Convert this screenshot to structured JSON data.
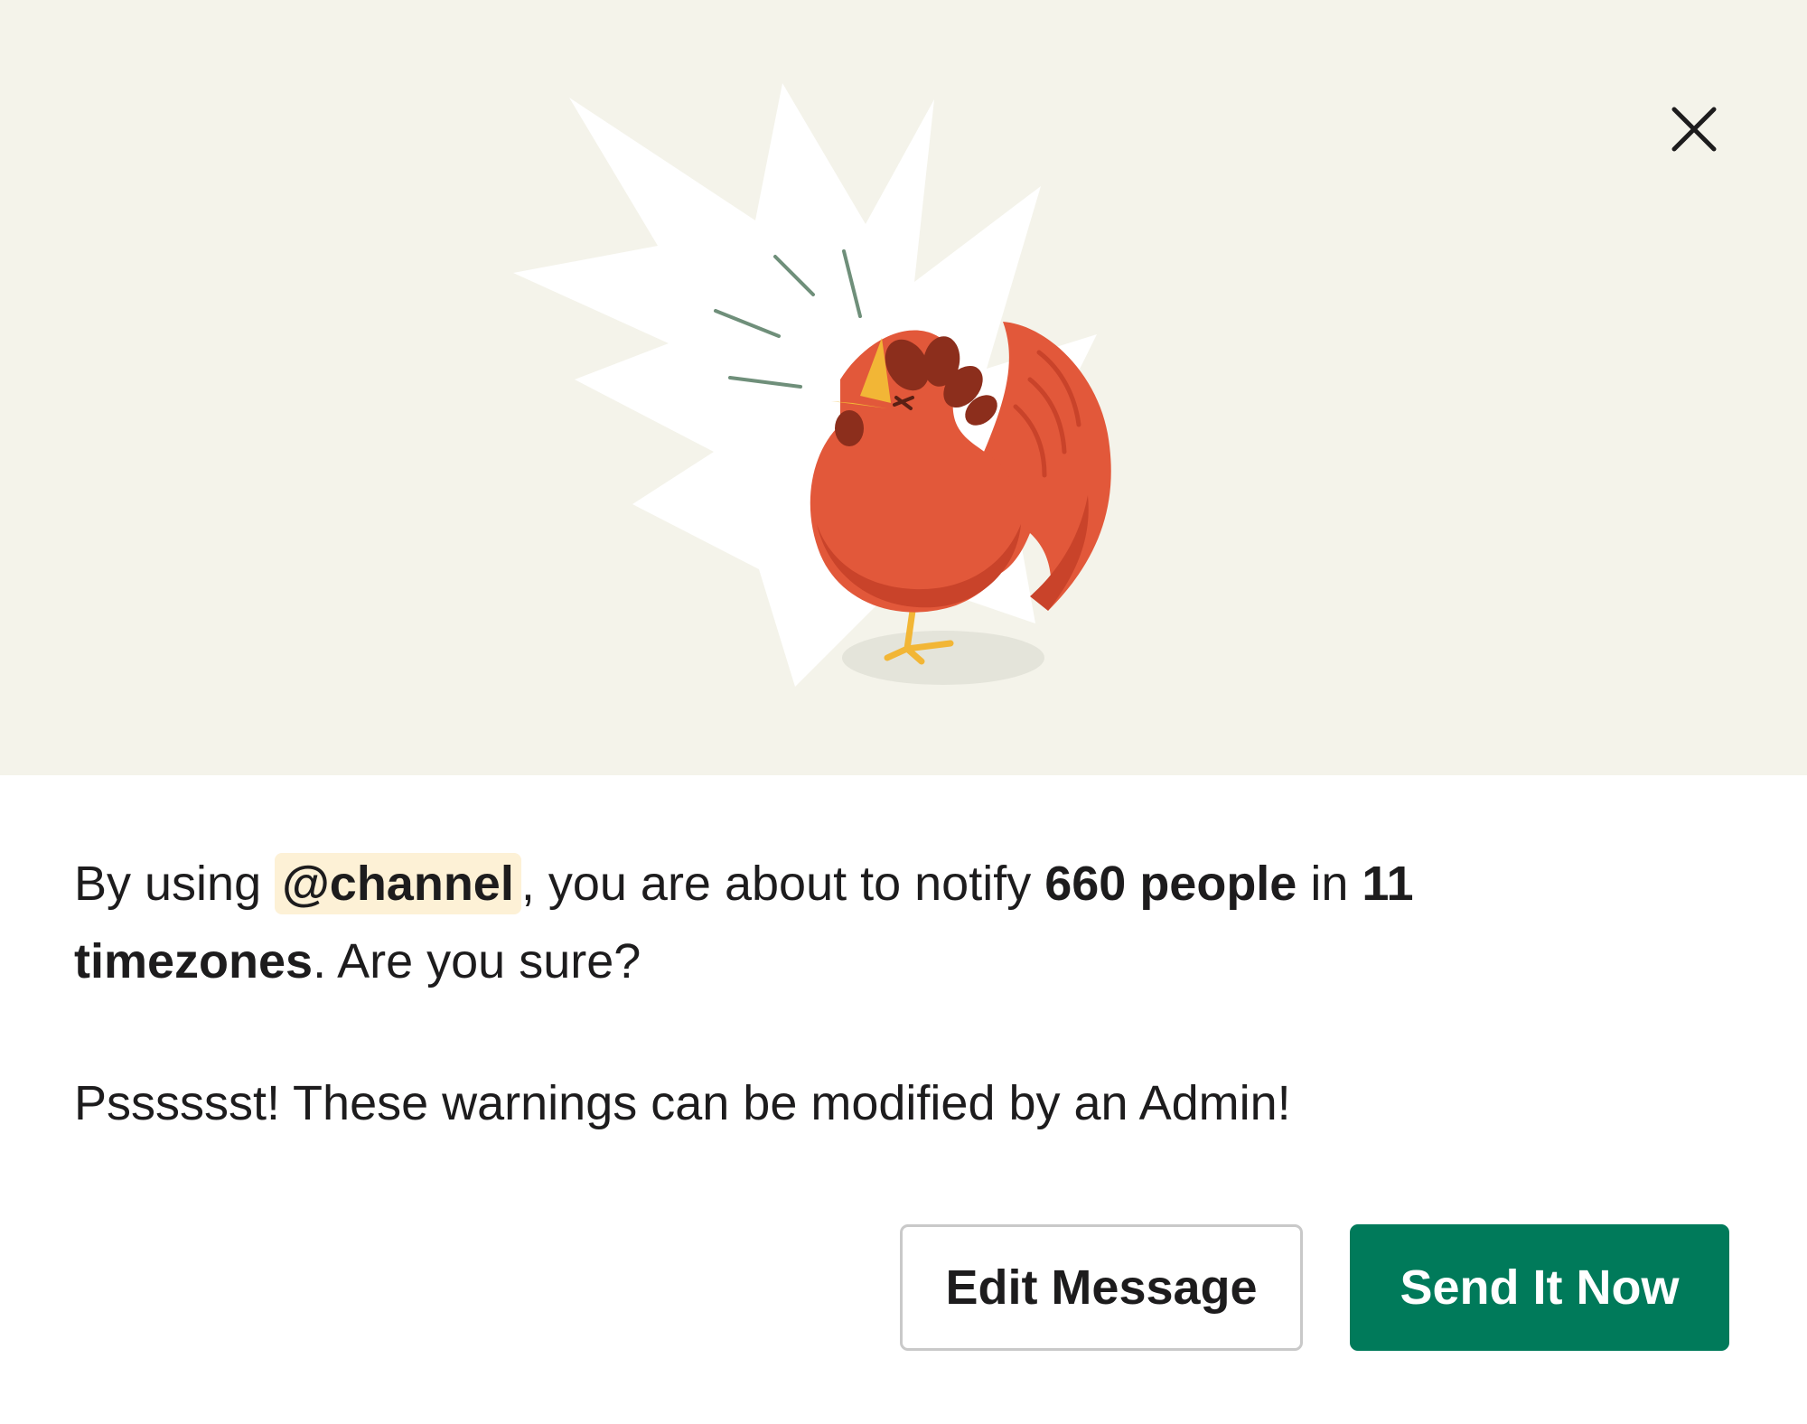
{
  "dialog": {
    "close_icon": "close-icon",
    "illustration": "crowing-rooster-illustration",
    "message": {
      "prefix": "By using ",
      "mention": "@channel",
      "middle": ", you are about to notify ",
      "people": "660 people",
      "in": " in ",
      "timezones": "11 timezones",
      "suffix": ". Are you sure?"
    },
    "note": "Psssssst! These warnings can be modified by an Admin!",
    "buttons": {
      "edit_label": "Edit Message",
      "send_label": "Send It Now"
    }
  },
  "colors": {
    "hero_background": "#f4f3ea",
    "mention_background": "#fdf1d6",
    "primary_button": "#007a5a",
    "rooster_body": "#e2583a",
    "rooster_comb": "#8c2e1c",
    "beak": "#f2b636"
  }
}
